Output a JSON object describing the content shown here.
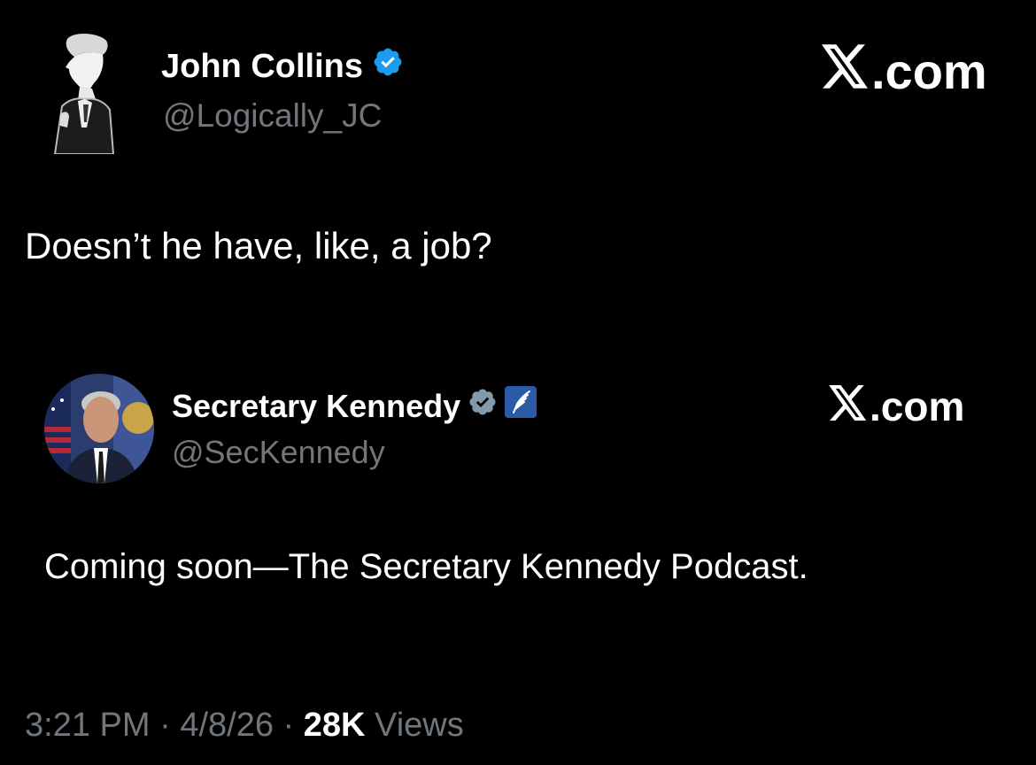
{
  "tweet": {
    "author": {
      "name": "John Collins",
      "handle": "@Logically_JC",
      "verified_icon": "verified-badge-icon",
      "avatar_icon": "profile-silhouette-avatar"
    },
    "brand": {
      "logo_icon": "x-logo-icon",
      "suffix": ".com"
    },
    "text": "Doesn’t he have, like, a job?"
  },
  "quoted_tweet": {
    "author": {
      "name": "Secretary Kennedy",
      "handle": "@SecKennedy",
      "verified_icon": "gray-verified-badge-icon",
      "affiliate_icon": "hhs-eagle-icon",
      "avatar_icon": "profile-photo-avatar"
    },
    "brand": {
      "logo_icon": "x-logo-icon",
      "suffix": ".com"
    },
    "text": "Coming soon—The Secretary Kennedy Podcast."
  },
  "footer": {
    "time": "3:21 PM",
    "separator": "·",
    "date": "4/8/26",
    "views_count": "28K",
    "views_label": "Views"
  },
  "colors": {
    "background": "#000000",
    "text_primary": "#ffffff",
    "text_secondary": "#71767b",
    "verified_blue": "#1d9bf0",
    "verified_gray": "#829aab",
    "hhs_blue": "#2a5aa8"
  }
}
